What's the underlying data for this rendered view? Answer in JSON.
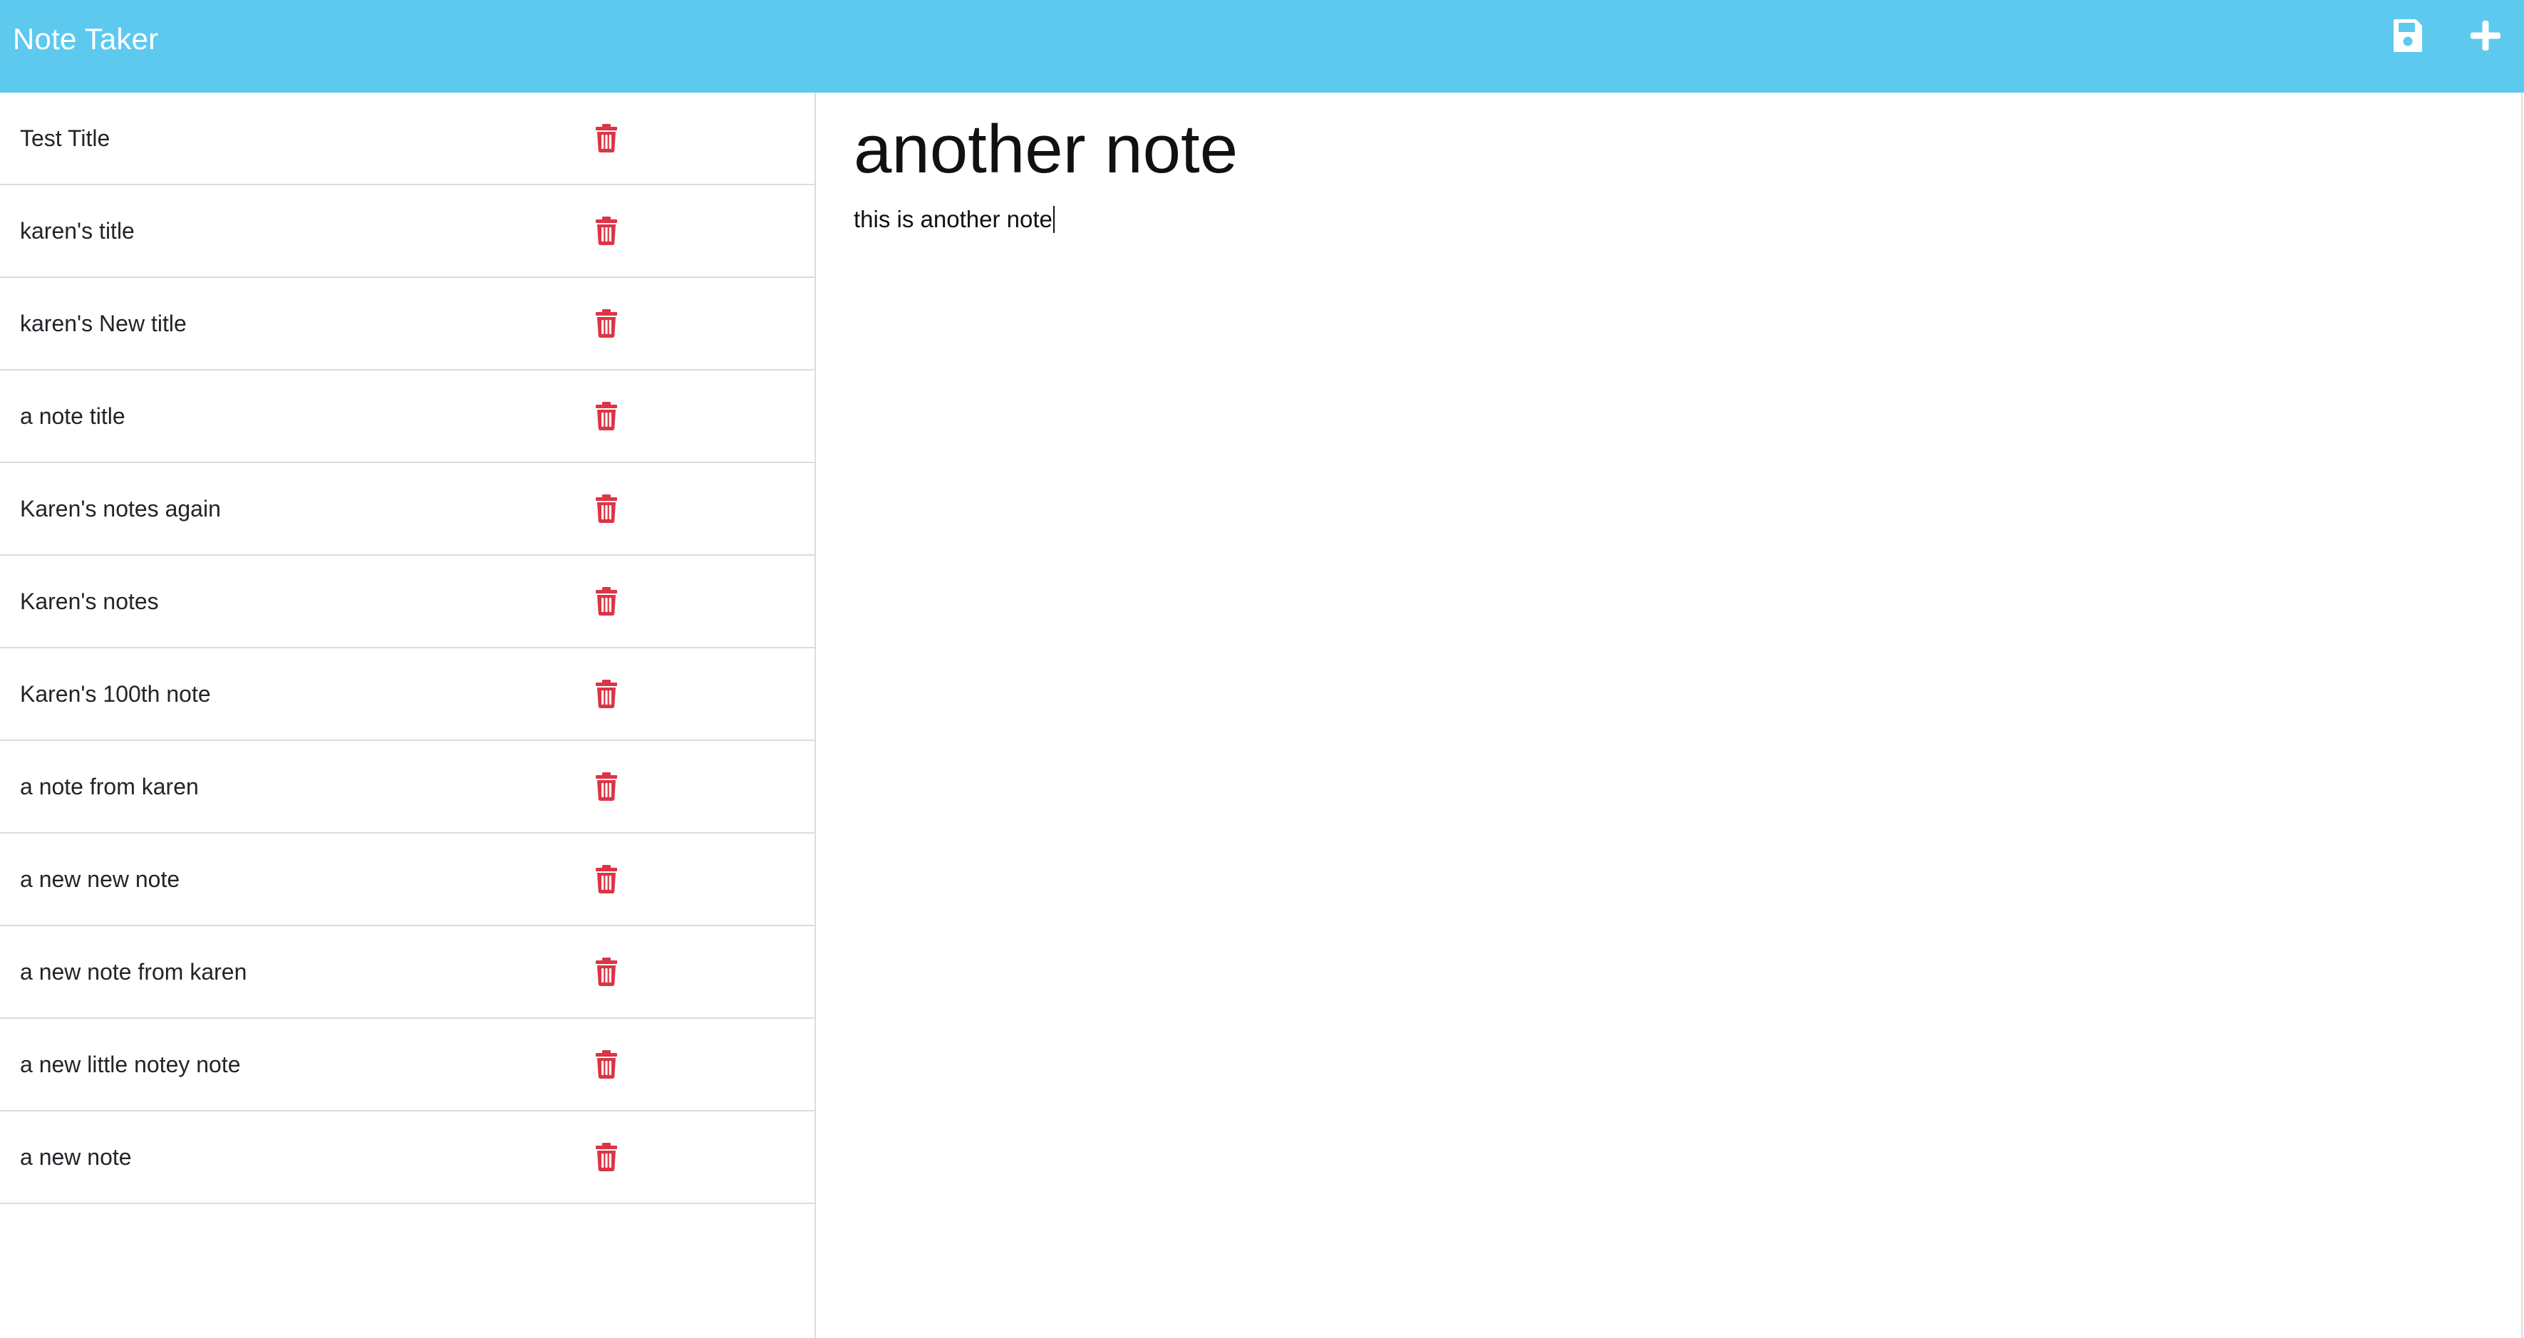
{
  "app": {
    "title": "Note Taker"
  },
  "toolbar": {
    "save_icon": "floppy-disk-save-icon",
    "new_icon": "plus-new-note-icon"
  },
  "colors": {
    "navbar": "#5ec9ee",
    "delete_icon": "#dc3545",
    "divider": "#dcdcdc"
  },
  "notes": [
    {
      "title": "Test Title"
    },
    {
      "title": "karen's title"
    },
    {
      "title": "karen's New title"
    },
    {
      "title": "a note title"
    },
    {
      "title": "Karen's notes again"
    },
    {
      "title": "Karen's notes"
    },
    {
      "title": "Karen's 100th note"
    },
    {
      "title": "a note from karen"
    },
    {
      "title": "a new new note"
    },
    {
      "title": "a new note from karen"
    },
    {
      "title": "a new little notey note"
    },
    {
      "title": "a new note"
    }
  ],
  "active_note": {
    "title": "another note",
    "text": "this is another note"
  }
}
